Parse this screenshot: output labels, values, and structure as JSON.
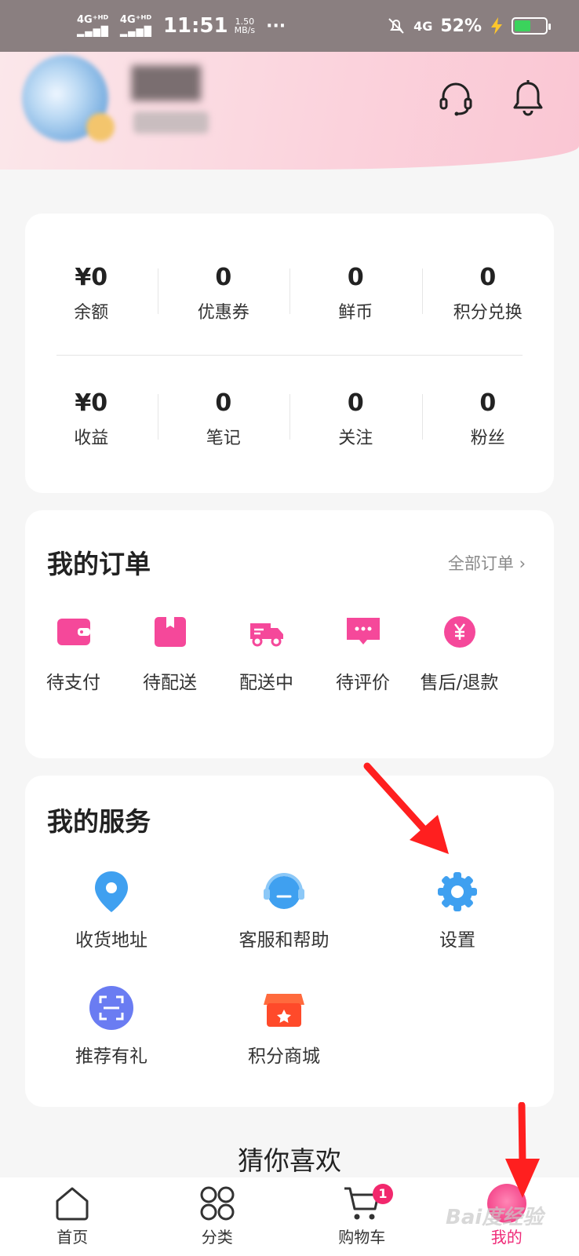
{
  "status_bar": {
    "signal1": "4G⁺ᴴᴰ",
    "signal2": "4G⁺ᴴᴰ",
    "time": "11:51",
    "speed_value": "1.50",
    "speed_unit": "MB/s",
    "dots": "···",
    "network": "4G",
    "battery_percent": "52%",
    "battery_level": 0.52,
    "colors": {
      "battery": "#3bd35c",
      "charging": "#ffc62b"
    }
  },
  "header": {
    "icons": [
      "headset-icon",
      "bell-icon"
    ]
  },
  "stats": {
    "row1": [
      {
        "value": "¥0",
        "label": "余额"
      },
      {
        "value": "0",
        "label": "优惠券"
      },
      {
        "value": "0",
        "label": "鲜币"
      },
      {
        "value": "0",
        "label": "积分兑换"
      }
    ],
    "row2": [
      {
        "value": "¥0",
        "label": "收益"
      },
      {
        "value": "0",
        "label": "笔记"
      },
      {
        "value": "0",
        "label": "关注"
      },
      {
        "value": "0",
        "label": "粉丝"
      }
    ]
  },
  "orders": {
    "title": "我的订单",
    "all_link": "全部订单",
    "items": [
      {
        "label": "待支付",
        "icon": "wallet-icon"
      },
      {
        "label": "待配送",
        "icon": "package-icon"
      },
      {
        "label": "配送中",
        "icon": "truck-icon"
      },
      {
        "label": "待评价",
        "icon": "comment-icon"
      },
      {
        "label": "售后/退款",
        "icon": "refund-icon"
      }
    ]
  },
  "services": {
    "title": "我的服务",
    "items": [
      {
        "label": "收货地址",
        "icon": "location-pin-icon"
      },
      {
        "label": "客服和帮助",
        "icon": "customer-service-icon"
      },
      {
        "label": "设置",
        "icon": "gear-icon"
      },
      {
        "label": "推荐有礼",
        "icon": "scan-icon"
      },
      {
        "label": "积分商城",
        "icon": "store-icon"
      }
    ]
  },
  "guess": {
    "title": "猜你喜欢"
  },
  "tabbar": {
    "items": [
      {
        "label": "首页",
        "icon": "home-icon"
      },
      {
        "label": "分类",
        "icon": "category-icon"
      },
      {
        "label": "购物车",
        "icon": "cart-icon",
        "badge": "1"
      },
      {
        "label": "我的",
        "icon": "profile-icon",
        "active": true
      }
    ],
    "colors": {
      "active": "#ef2a78",
      "badge": "#f2286d"
    }
  },
  "theme": {
    "accent": "#ef2a78",
    "icon_pink": "#f5489a",
    "icon_blue": "#3fa0f0",
    "annotation_red": "#ff1f1f"
  },
  "watermark": "Bai度经验"
}
